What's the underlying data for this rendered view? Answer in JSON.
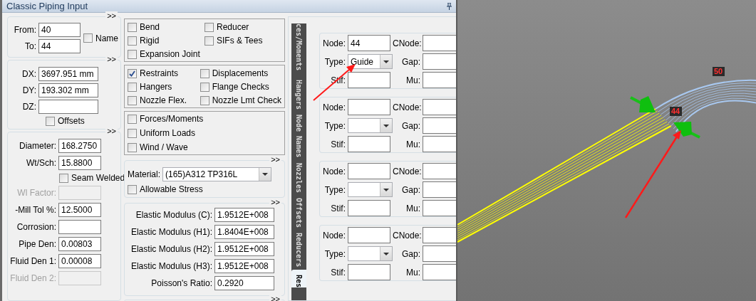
{
  "window": {
    "title": "Classic Piping Input"
  },
  "node_section": {
    "expand": ">>",
    "from": {
      "label": "From:",
      "value": "40"
    },
    "to": {
      "label": "To:",
      "value": "44"
    },
    "name_checkbox": {
      "label": "Name",
      "checked": false
    }
  },
  "delta_section": {
    "expand": ">>",
    "fields": [
      {
        "label": "DX:",
        "value": "3697.951 mm"
      },
      {
        "label": "DY:",
        "value": "193.302 mm"
      },
      {
        "label": "DZ:"
      }
    ],
    "offsets_checkbox": {
      "label": "Offsets",
      "checked": false
    }
  },
  "pipe_section": {
    "expand": ">>",
    "rows": [
      {
        "kind": "field",
        "label": "Diameter:",
        "value": "168.2750",
        "disabled": false
      },
      {
        "kind": "field",
        "label": "Wt/Sch:",
        "value": "15.8800",
        "disabled": false
      },
      {
        "kind": "checkbox",
        "label": "Seam Welded",
        "checked": false
      },
      {
        "kind": "field",
        "label": "Wl Factor:",
        "disabled": true
      },
      {
        "kind": "field",
        "label": "-Mill Tol %:",
        "value": "12.5000",
        "disabled": false
      },
      {
        "kind": "field",
        "label": "Corrosion:",
        "disabled": false
      },
      {
        "kind": "field",
        "label": "Pipe Den:",
        "value": "0.00803",
        "disabled": false
      },
      {
        "kind": "field",
        "label": "Fluid Den 1:",
        "value": "0.00008",
        "disabled": false
      },
      {
        "kind": "field",
        "label": "Fluid Den 2:",
        "disabled": true
      }
    ]
  },
  "option_groups": [
    {
      "kind": "grid",
      "items": [
        {
          "label": "Bend",
          "checked": false
        },
        {
          "label": "Reducer",
          "checked": false
        },
        {
          "label": "Rigid",
          "checked": false
        },
        {
          "label": "SIFs & Tees",
          "checked": false
        },
        {
          "label": "Expansion Joint",
          "checked": false
        }
      ]
    },
    {
      "kind": "grid",
      "items": [
        {
          "label": "Restraints",
          "checked": true
        },
        {
          "label": "Displacements",
          "checked": false
        },
        {
          "label": "Hangers",
          "checked": false
        },
        {
          "label": "Flange Checks",
          "checked": false
        },
        {
          "label": "Nozzle Flex.",
          "checked": false
        },
        {
          "label": "Nozzle Lmt Check",
          "checked": false
        }
      ]
    },
    {
      "kind": "list",
      "items": [
        {
          "label": "Forces/Moments",
          "checked": false
        },
        {
          "label": "Uniform Loads",
          "checked": false
        },
        {
          "label": "Wind / Wave",
          "checked": false
        }
      ]
    }
  ],
  "material_section": {
    "expand": ">>",
    "label": "Material:",
    "value": "(165)A312 TP316L",
    "allowable_stress": {
      "label": "Allowable Stress",
      "checked": false
    }
  },
  "elastic_section": {
    "expand": ">>",
    "fields": [
      {
        "label": "Elastic Modulus (C):",
        "value": "1.9512E+008"
      },
      {
        "label": "Elastic Modulus (H1):",
        "value": "1.8404E+008"
      },
      {
        "label": "Elastic Modulus (H2):",
        "value": "1.9512E+008"
      },
      {
        "label": "Elastic Modulus (H3):",
        "value": "1.9512E+008"
      },
      {
        "label": "Poisson's Ratio:",
        "value": "0.2920"
      }
    ]
  },
  "next_section": {
    "expand": ">>"
  },
  "side_tabs": [
    {
      "label": "ces/Moments",
      "selected": false
    },
    {
      "label": "Hangers",
      "selected": false
    },
    {
      "label": "Node Names",
      "selected": false
    },
    {
      "label": "Nozzles",
      "selected": false
    },
    {
      "label": "Offsets",
      "selected": false
    },
    {
      "label": "Reducers",
      "selected": false
    },
    {
      "label": "Res",
      "selected": true
    }
  ],
  "restraints": [
    {
      "node": {
        "label": "Node:",
        "value": "44"
      },
      "cnode": {
        "label": "CNode:"
      },
      "type": {
        "label": "Type:",
        "value": "Guide"
      },
      "gap": {
        "label": "Gap:"
      },
      "stif": {
        "label": "Stif:"
      },
      "mu": {
        "label": "Mu:"
      }
    },
    {
      "node": {
        "label": "Node:"
      },
      "cnode": {
        "label": "CNode:"
      },
      "type": {
        "label": "Type:"
      },
      "gap": {
        "label": "Gap:"
      },
      "stif": {
        "label": "Stif:"
      },
      "mu": {
        "label": "Mu:"
      }
    },
    {
      "node": {
        "label": "Node:"
      },
      "cnode": {
        "label": "CNode:"
      },
      "type": {
        "label": "Type:"
      },
      "gap": {
        "label": "Gap:"
      },
      "stif": {
        "label": "Stif:"
      },
      "mu": {
        "label": "Mu:"
      }
    },
    {
      "node": {
        "label": "Node:"
      },
      "cnode": {
        "label": "CNode:"
      },
      "type": {
        "label": "Type:"
      },
      "gap": {
        "label": "Gap:"
      },
      "stif": {
        "label": "Stif:"
      },
      "mu": {
        "label": "Mu:"
      }
    }
  ],
  "viewport": {
    "node_labels": [
      {
        "label": "50"
      },
      {
        "label": "44"
      }
    ]
  }
}
